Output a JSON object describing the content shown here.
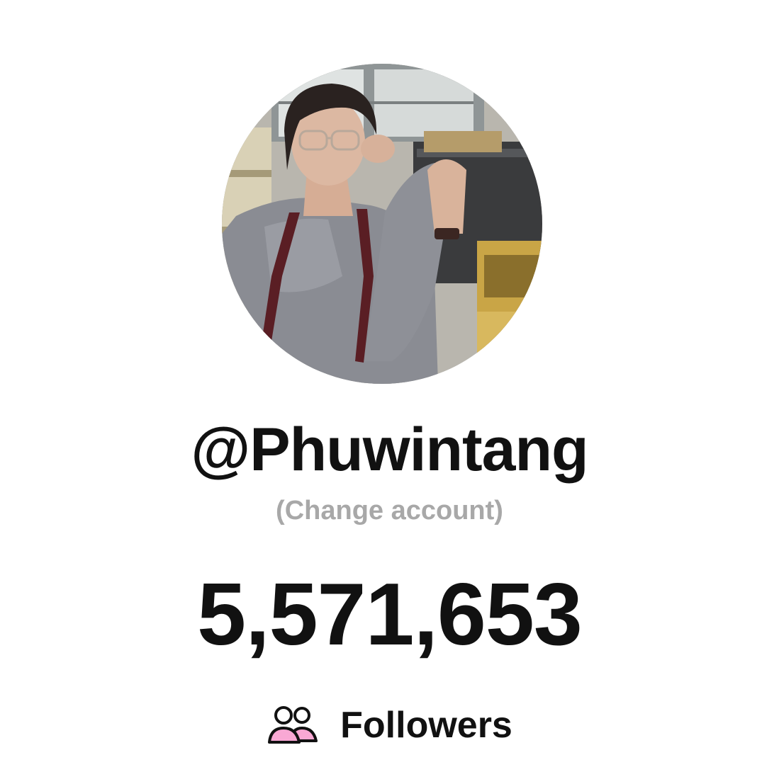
{
  "profile": {
    "avatar_icon": "profile-photo",
    "username": "@Phuwintang",
    "change_account_label": "(Change account)"
  },
  "stats": {
    "followers_count": "5,571,653",
    "followers_label": "Followers",
    "followers_icon": "people-icon"
  },
  "colors": {
    "text": "#111111",
    "muted": "#a8a8a8",
    "icon_accent": "#f9a8d4"
  }
}
